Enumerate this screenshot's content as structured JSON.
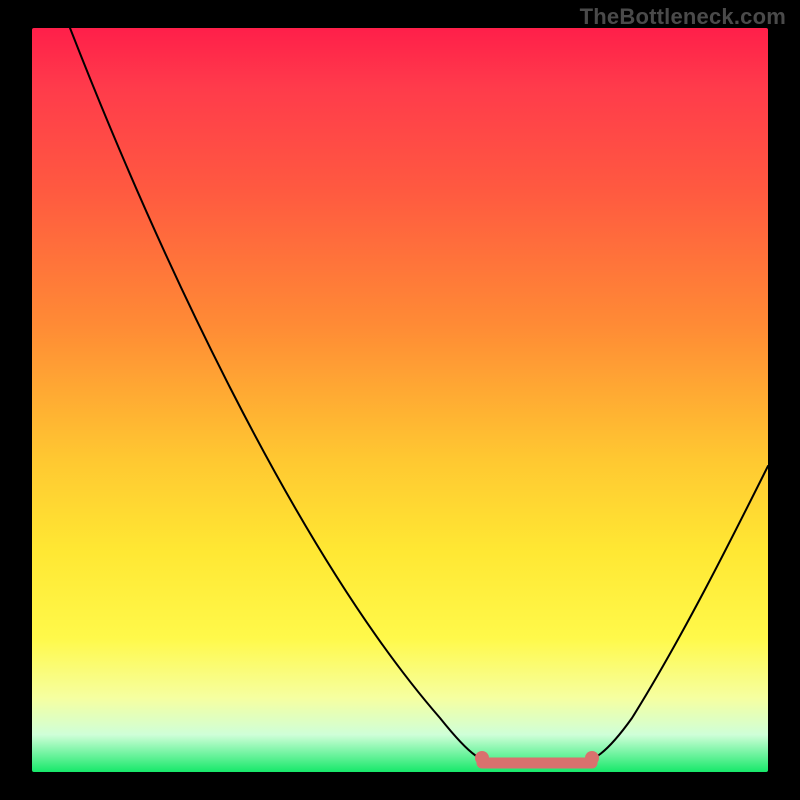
{
  "watermark": "TheBottleneck.com",
  "chart_data": {
    "type": "line",
    "title": "",
    "xlabel": "",
    "ylabel": "",
    "xlim": [
      0,
      100
    ],
    "ylim": [
      0,
      100
    ],
    "grid": false,
    "legend": false,
    "series": [
      {
        "name": "bottleneck-curve",
        "x": [
          0,
          10,
          20,
          30,
          40,
          50,
          56,
          60,
          66,
          70,
          74,
          80,
          90,
          100
        ],
        "values": [
          100,
          85,
          70,
          55,
          40,
          24,
          12,
          5,
          0,
          0,
          0,
          8,
          24,
          42
        ]
      }
    ],
    "highlight": {
      "name": "optimal-range",
      "x_start": 60,
      "x_end": 74,
      "y": 0
    },
    "background_gradient": {
      "top_hex": "#ff1f4a",
      "mid_hex": "#ffe733",
      "bottom_hex": "#17e86a"
    }
  }
}
